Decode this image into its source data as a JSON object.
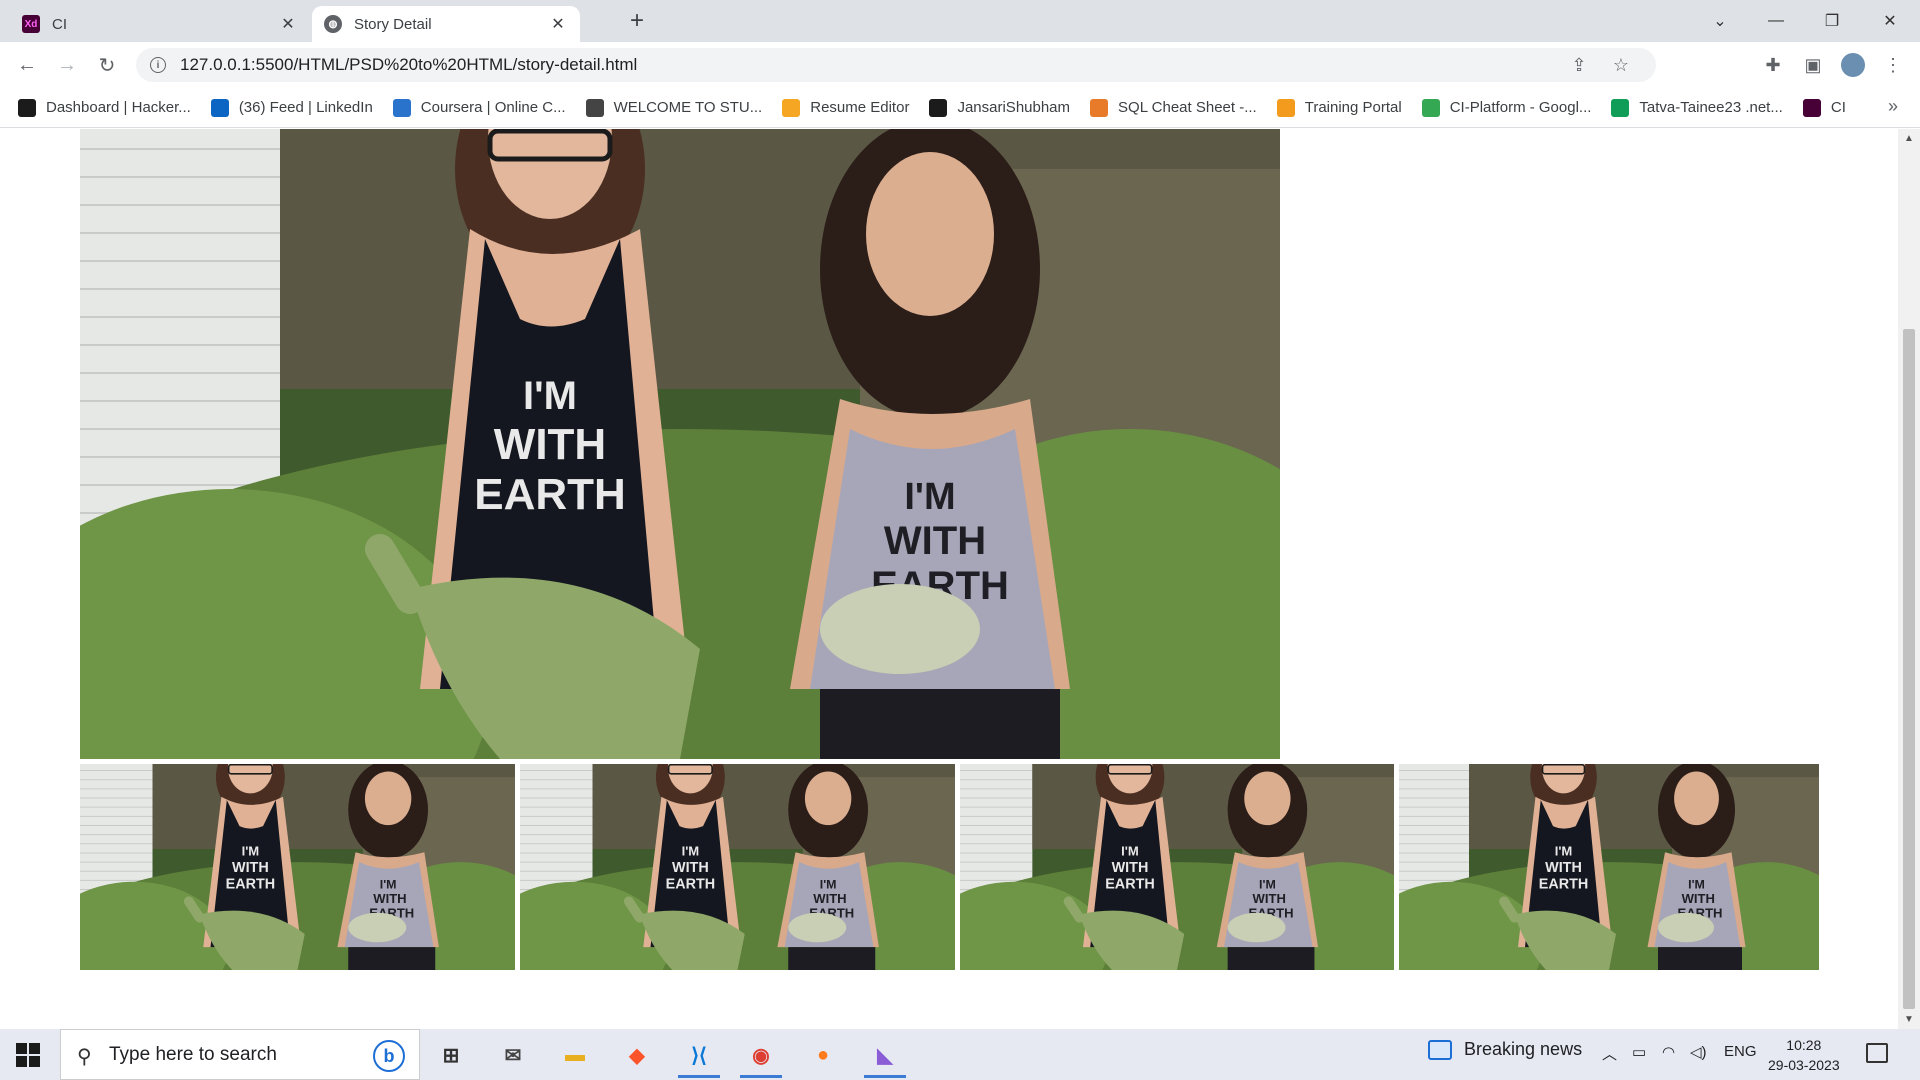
{
  "browser": {
    "tabs": [
      {
        "label": "CI",
        "icon": "adobe-xd-icon",
        "active": false
      },
      {
        "label": "Story Detail",
        "icon": "globe-icon",
        "active": true
      }
    ],
    "url": "127.0.0.1:5500/HTML/PSD%20to%20HTML/story-detail.html",
    "bookmarks": [
      {
        "label": "Dashboard | Hacker...",
        "icon": "hackerrank-icon",
        "color": "#1b1b1b"
      },
      {
        "label": "(36) Feed | LinkedIn",
        "icon": "linkedin-icon",
        "color": "#0a66c2"
      },
      {
        "label": "Coursera | Online C...",
        "icon": "coursera-icon",
        "color": "#2a73cc"
      },
      {
        "label": "WELCOME TO STU...",
        "icon": "w-icon",
        "color": "#444444"
      },
      {
        "label": "Resume Editor",
        "icon": "h-icon",
        "color": "#f5a623"
      },
      {
        "label": "JansariShubham",
        "icon": "github-icon",
        "color": "#1b1b1b"
      },
      {
        "label": "SQL Cheat Sheet -...",
        "icon": "sql-icon",
        "color": "#e87b2a"
      },
      {
        "label": "Training Portal",
        "icon": "training-icon",
        "color": "#f29b1d"
      },
      {
        "label": "CI-Platform - Googl...",
        "icon": "google-drive-icon",
        "color": "#34a853"
      },
      {
        "label": "Tatva-Tainee23 .net...",
        "icon": "google-sheets-icon",
        "color": "#0f9d58"
      },
      {
        "label": "CI",
        "icon": "adobe-xd-icon",
        "color": "#470137"
      }
    ]
  },
  "page": {
    "main_image": {
      "shirt_text_1": "I'M WITH EARTH",
      "shirt_text_2": "I'M WITH EARTH"
    },
    "thumbnails": [
      {
        "label": "thumbnail-1"
      },
      {
        "label": "thumbnail-2"
      },
      {
        "label": "thumbnail-3"
      },
      {
        "label": "thumbnail-4"
      }
    ]
  },
  "taskbar": {
    "search_placeholder": "Type here to search",
    "news": "Breaking news",
    "language": "ENG",
    "time": "10:28",
    "date": "29-03-2023"
  }
}
